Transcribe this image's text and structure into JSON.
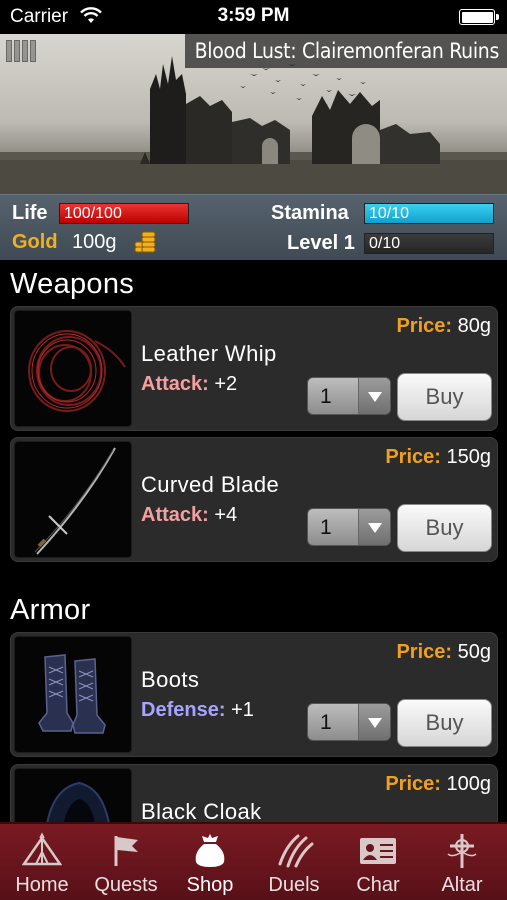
{
  "status_bar": {
    "carrier": "Carrier",
    "time": "3:59 PM"
  },
  "banner": {
    "location": "Blood Lust: Clairemonferan Ruins"
  },
  "stats": {
    "life_label": "Life",
    "life_value": "100/100",
    "stamina_label": "Stamina",
    "stamina_value": "10/10",
    "gold_label": "Gold",
    "gold_value": "100g",
    "level_label": "Level 1",
    "level_value": "0/10"
  },
  "sections": {
    "weapons": "Weapons",
    "armor": "Armor"
  },
  "items": [
    {
      "name": "Leather Whip",
      "stat_label": "Attack:",
      "stat_value": "+2",
      "price_label": "Price:",
      "price_value": "80g",
      "qty": "1",
      "buy": "Buy"
    },
    {
      "name": "Curved Blade",
      "stat_label": "Attack:",
      "stat_value": "+4",
      "price_label": "Price:",
      "price_value": "150g",
      "qty": "1",
      "buy": "Buy"
    },
    {
      "name": "Boots",
      "stat_label": "Defense:",
      "stat_value": "+1",
      "price_label": "Price:",
      "price_value": "50g",
      "qty": "1",
      "buy": "Buy"
    },
    {
      "name": "Black Cloak",
      "price_label": "Price:",
      "price_value": "100g"
    }
  ],
  "tabs": [
    {
      "label": "Home",
      "icon": "tent-icon"
    },
    {
      "label": "Quests",
      "icon": "flag-icon"
    },
    {
      "label": "Shop",
      "icon": "money-bag-icon"
    },
    {
      "label": "Duels",
      "icon": "claw-marks-icon"
    },
    {
      "label": "Char",
      "icon": "id-card-icon"
    },
    {
      "label": "Altar",
      "icon": "cross-icon"
    }
  ],
  "colors": {
    "life": "#cc1111",
    "stamina": "#19b4dc",
    "gold": "#f0b020",
    "tabbar": "#6a1620"
  }
}
